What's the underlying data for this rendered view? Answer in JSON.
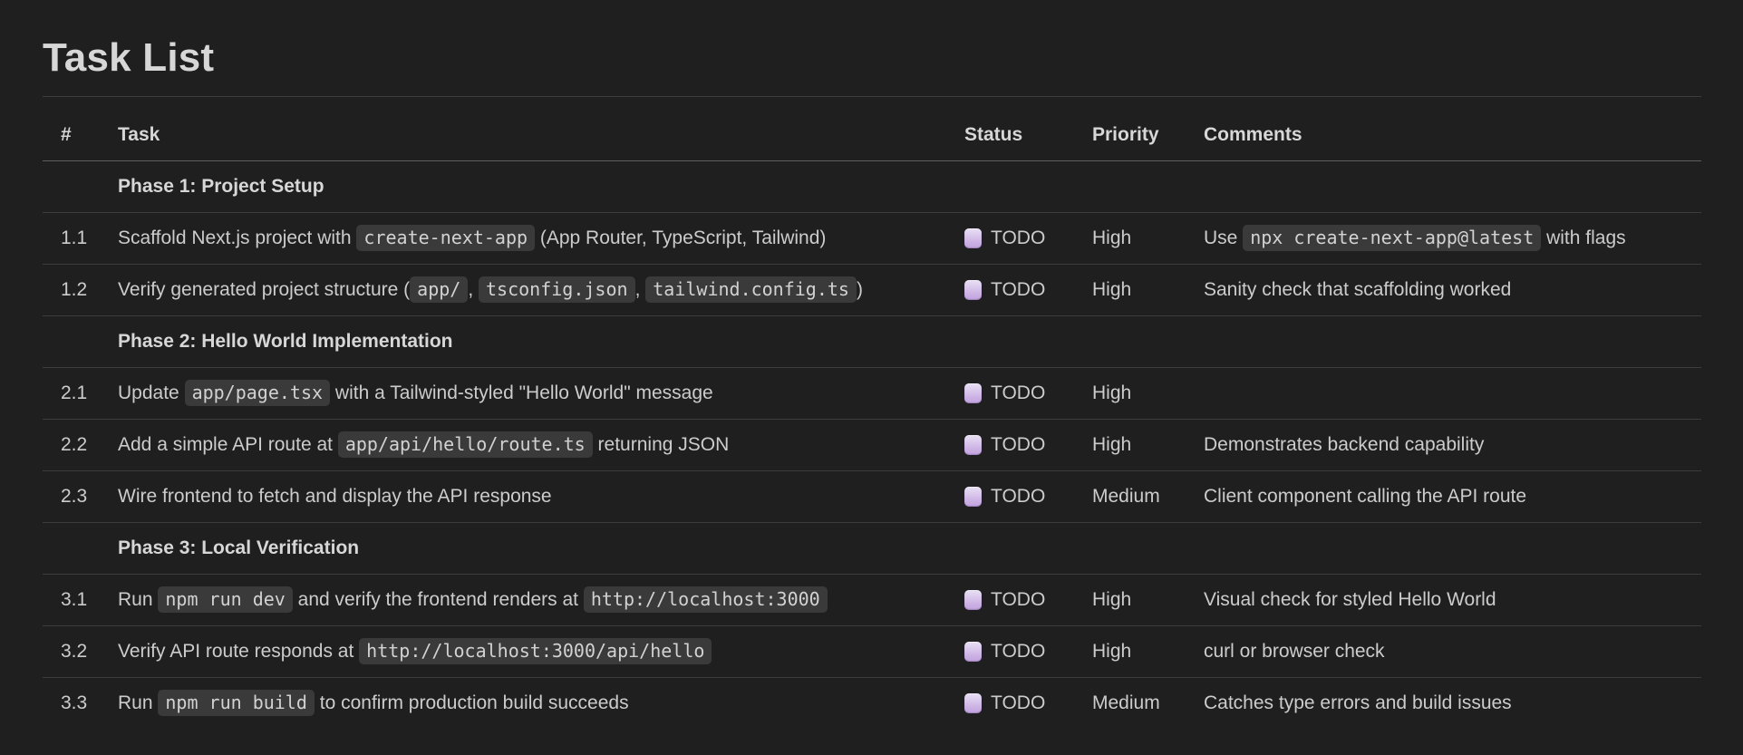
{
  "page": {
    "title": "Task List"
  },
  "colors": {
    "background": "#1f1f1f",
    "text": "#cccccc",
    "heading_text": "#d7d7d7",
    "code_background": "#3a3a3a",
    "row_divider": "#3c3c3c",
    "header_divider": "#5f5f5f",
    "checkbox_top": "#e9e1f4",
    "checkbox_bottom": "#c2a4de"
  },
  "table": {
    "columns": [
      {
        "key": "num",
        "label": "#"
      },
      {
        "key": "task",
        "label": "Task"
      },
      {
        "key": "status",
        "label": "Status"
      },
      {
        "key": "priority",
        "label": "Priority"
      },
      {
        "key": "comments",
        "label": "Comments"
      }
    ],
    "status_label": "TODO",
    "rows": [
      {
        "type": "section",
        "title": "Phase 1: Project Setup"
      },
      {
        "type": "task",
        "num": "1.1",
        "task": [
          {
            "t": "Scaffold Next.js project with "
          },
          {
            "c": "create-next-app"
          },
          {
            "t": " (App Router, TypeScript, Tailwind)"
          }
        ],
        "status": "TODO",
        "priority": "High",
        "comments": [
          {
            "t": "Use "
          },
          {
            "c": "npx create-next-app@latest"
          },
          {
            "t": " with flags"
          }
        ]
      },
      {
        "type": "task",
        "num": "1.2",
        "task": [
          {
            "t": "Verify generated project structure ("
          },
          {
            "c": "app/"
          },
          {
            "t": ", "
          },
          {
            "c": "tsconfig.json"
          },
          {
            "t": ", "
          },
          {
            "c": "tailwind.config.ts"
          },
          {
            "t": ")"
          }
        ],
        "status": "TODO",
        "priority": "High",
        "comments": [
          {
            "t": "Sanity check that scaffolding worked"
          }
        ]
      },
      {
        "type": "section",
        "title": "Phase 2: Hello World Implementation"
      },
      {
        "type": "task",
        "num": "2.1",
        "task": [
          {
            "t": "Update "
          },
          {
            "c": "app/page.tsx"
          },
          {
            "t": " with a Tailwind-styled \"Hello World\" message"
          }
        ],
        "status": "TODO",
        "priority": "High",
        "comments": []
      },
      {
        "type": "task",
        "num": "2.2",
        "task": [
          {
            "t": "Add a simple API route at "
          },
          {
            "c": "app/api/hello/route.ts"
          },
          {
            "t": " returning JSON"
          }
        ],
        "status": "TODO",
        "priority": "High",
        "comments": [
          {
            "t": "Demonstrates backend capability"
          }
        ]
      },
      {
        "type": "task",
        "num": "2.3",
        "task": [
          {
            "t": "Wire frontend to fetch and display the API response"
          }
        ],
        "status": "TODO",
        "priority": "Medium",
        "comments": [
          {
            "t": "Client component calling the API route"
          }
        ]
      },
      {
        "type": "section",
        "title": "Phase 3: Local Verification"
      },
      {
        "type": "task",
        "num": "3.1",
        "task": [
          {
            "t": "Run "
          },
          {
            "c": "npm run dev"
          },
          {
            "t": " and verify the frontend renders at "
          },
          {
            "c": "http://localhost:3000"
          }
        ],
        "status": "TODO",
        "priority": "High",
        "comments": [
          {
            "t": "Visual check for styled Hello World"
          }
        ]
      },
      {
        "type": "task",
        "num": "3.2",
        "task": [
          {
            "t": "Verify API route responds at "
          },
          {
            "c": "http://localhost:3000/api/hello"
          }
        ],
        "status": "TODO",
        "priority": "High",
        "comments": [
          {
            "t": "curl or browser check"
          }
        ]
      },
      {
        "type": "task",
        "num": "3.3",
        "task": [
          {
            "t": "Run "
          },
          {
            "c": "npm run build"
          },
          {
            "t": " to confirm production build succeeds"
          }
        ],
        "status": "TODO",
        "priority": "Medium",
        "comments": [
          {
            "t": "Catches type errors and build issues"
          }
        ]
      }
    ]
  }
}
